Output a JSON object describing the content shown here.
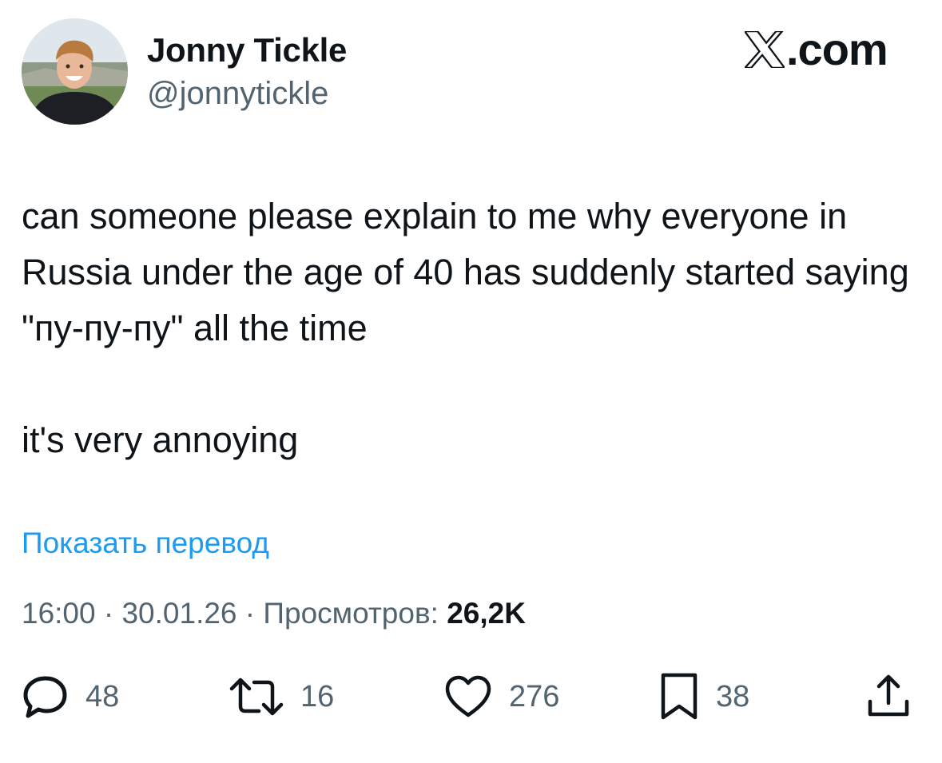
{
  "tweet": {
    "author": {
      "display_name": "Jonny Tickle",
      "handle": "@jonnytickle"
    },
    "brand": "X.com",
    "text": "can someone please explain to me why everyone in Russia under the age of 40 has suddenly started saying \"пу-пу-пу\" all the time\n\nit's very annoying",
    "translate_link": "Показать перевод",
    "meta": {
      "time": "16:00",
      "separator": " · ",
      "date": "30.01.26",
      "views_label": "Просмотров: ",
      "views_count": "26,2K"
    },
    "actions": {
      "replies": "48",
      "reposts": "16",
      "likes": "276",
      "bookmarks": "38"
    }
  },
  "icons": {
    "reply": "speech-bubble-icon",
    "repost": "repost-arrows-icon",
    "like": "heart-icon",
    "bookmark": "bookmark-icon",
    "share": "share-upload-icon",
    "brand": "x-logo-icon"
  },
  "colors": {
    "text": "#0f1419",
    "secondary": "#536471",
    "link": "#1d9bf0",
    "background": "#ffffff"
  }
}
